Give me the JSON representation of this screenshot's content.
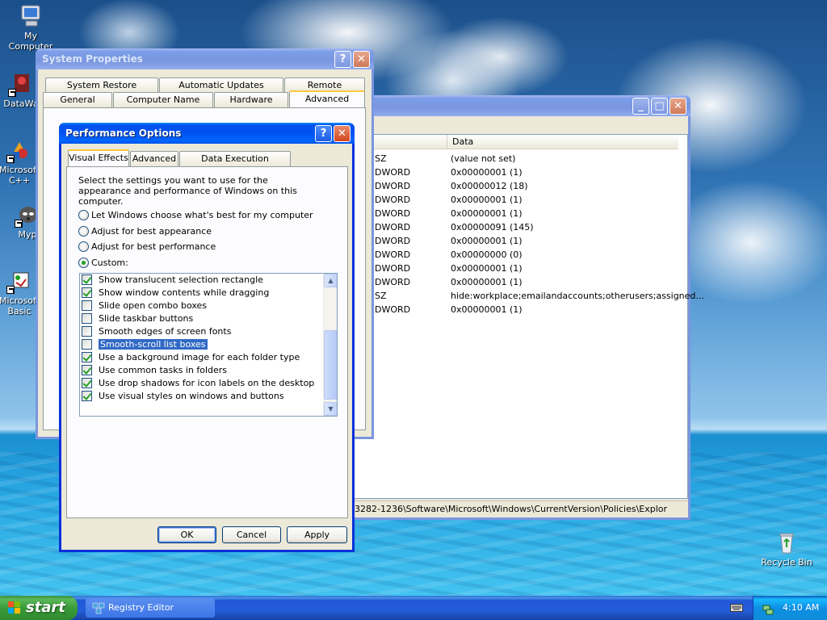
{
  "desktop": {
    "icons": [
      {
        "label": "My Computer"
      },
      {
        "label": "DataWa"
      },
      {
        "label": "Microsoft C++",
        "line1": "Microsoft",
        "line2": "C++"
      },
      {
        "label": "Myp"
      },
      {
        "label": "Microsoft Basic",
        "line1": "Microsoft",
        "line2": "Basic"
      },
      {
        "label": "Recycle Bin"
      }
    ]
  },
  "system_properties": {
    "title": "System Properties",
    "help": "?",
    "close": "✕",
    "tabs_row1": [
      "System Restore",
      "Automatic Updates",
      "Remote"
    ],
    "tabs_row2": [
      "General",
      "Computer Name",
      "Hardware",
      "Advanced"
    ]
  },
  "registry": {
    "minimize": "_",
    "maximize": "□",
    "close": "✕",
    "col_data": "Data",
    "rows": [
      {
        "type": "SZ",
        "data": "(value not set)"
      },
      {
        "type": "DWORD",
        "data": "0x00000001 (1)"
      },
      {
        "type": "DWORD",
        "data": "0x00000012 (18)"
      },
      {
        "type": "DWORD",
        "data": "0x00000001 (1)"
      },
      {
        "type": "DWORD",
        "data": "0x00000001 (1)"
      },
      {
        "type": "DWORD",
        "data": "0x00000091 (145)"
      },
      {
        "type": "DWORD",
        "data": "0x00000001 (1)"
      },
      {
        "type": "DWORD",
        "data": "0x00000000 (0)"
      },
      {
        "type": "DWORD",
        "data": "0x00000001 (1)"
      },
      {
        "type": "DWORD",
        "data": "0x00000001 (1)"
      },
      {
        "type": "SZ",
        "data": "hide:workplace;emailandaccounts;otherusers;assigned..."
      },
      {
        "type": "DWORD",
        "data": "0x00000001 (1)"
      }
    ],
    "status_path": "3282-1236\\Software\\Microsoft\\Windows\\CurrentVersion\\Policies\\Explor"
  },
  "perf_options": {
    "title": "Performance Options",
    "help": "?",
    "close": "✕",
    "tabs": [
      "Visual Effects",
      "Advanced",
      "Data Execution Prevention"
    ],
    "description": "Select the settings you want to use for the appearance and performance of Windows on this computer.",
    "radios": [
      {
        "label": "Let Windows choose what's best for my computer",
        "checked": false
      },
      {
        "label": "Adjust for best appearance",
        "checked": false
      },
      {
        "label": "Adjust for best performance",
        "checked": false
      },
      {
        "label": "Custom:",
        "checked": true
      }
    ],
    "settings": [
      {
        "label": "Show translucent selection rectangle",
        "checked": true
      },
      {
        "label": "Show window contents while dragging",
        "checked": true
      },
      {
        "label": "Slide open combo boxes",
        "checked": false
      },
      {
        "label": "Slide taskbar buttons",
        "checked": false
      },
      {
        "label": "Smooth edges of screen fonts",
        "checked": false
      },
      {
        "label": "Smooth-scroll list boxes",
        "checked": false,
        "selected": true
      },
      {
        "label": "Use a background image for each folder type",
        "checked": true
      },
      {
        "label": "Use common tasks in folders",
        "checked": true
      },
      {
        "label": "Use drop shadows for icon labels on the desktop",
        "checked": true
      },
      {
        "label": "Use visual styles on windows and buttons",
        "checked": true
      }
    ],
    "buttons": {
      "ok": "OK",
      "cancel": "Cancel",
      "apply": "Apply"
    }
  },
  "taskbar": {
    "start_label": "start",
    "tasks": [
      {
        "label": "Registry Editor"
      }
    ],
    "clock": "4:10 AM"
  },
  "colors": {
    "title_active": "#0053ee",
    "title_inactive": "#7a96df",
    "selection": "#316ac5",
    "check_green": "#21a121",
    "tab_highlight": "#ffc73c",
    "start_green": "#3a9a3a"
  }
}
